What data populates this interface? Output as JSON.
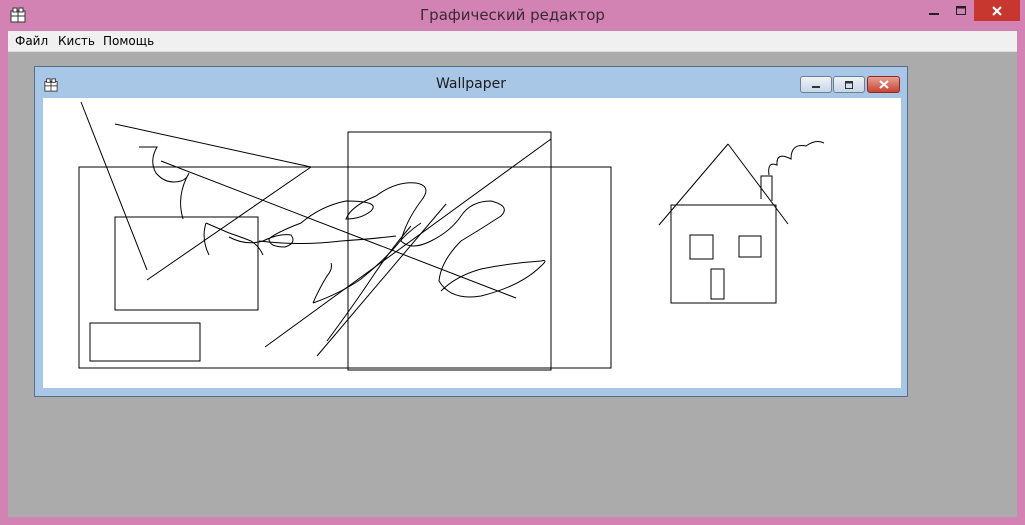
{
  "app": {
    "title": "Графический редактор"
  },
  "menu": {
    "items": [
      "Файл",
      "Кисть",
      "Помощь"
    ]
  },
  "child_window": {
    "title": "Wallpaper"
  },
  "colors": {
    "titlebar": "#d282b3",
    "workspace": "#ababab",
    "child_frame": "#a8c6e6",
    "close": "#c7362f"
  },
  "icons": [
    "app-icon",
    "minimize-icon",
    "maximize-icon",
    "close-icon"
  ]
}
